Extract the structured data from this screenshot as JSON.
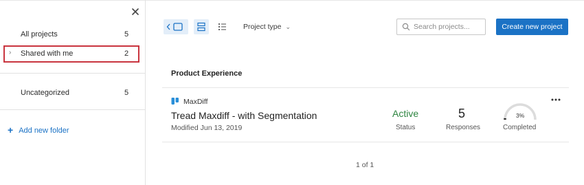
{
  "sidebar": {
    "close_icon": "close-icon",
    "folders": [
      {
        "label": "All projects",
        "count": "5"
      },
      {
        "label": "Shared with me",
        "count": "2"
      },
      {
        "label": "Uncategorized",
        "count": "5"
      }
    ],
    "add_folder_label": "Add new folder"
  },
  "toolbar": {
    "project_type_label": "Project type",
    "search_placeholder": "Search projects...",
    "create_label": "Create new project"
  },
  "section": {
    "title": "Product Experience"
  },
  "project": {
    "type": "MaxDiff",
    "name": "Tread Maxdiff - with Segmentation",
    "modified": "Modified Jun 13, 2019",
    "status_value": "Active",
    "status_label": "Status",
    "responses_value": "5",
    "responses_label": "Responses",
    "completed_percent": 3,
    "completed_text": "3%",
    "completed_label": "Completed"
  },
  "pagination": "1 of 1",
  "colors": {
    "accent": "#1b72c5",
    "active_status": "#2e8540",
    "highlight_box": "#c9343e"
  }
}
